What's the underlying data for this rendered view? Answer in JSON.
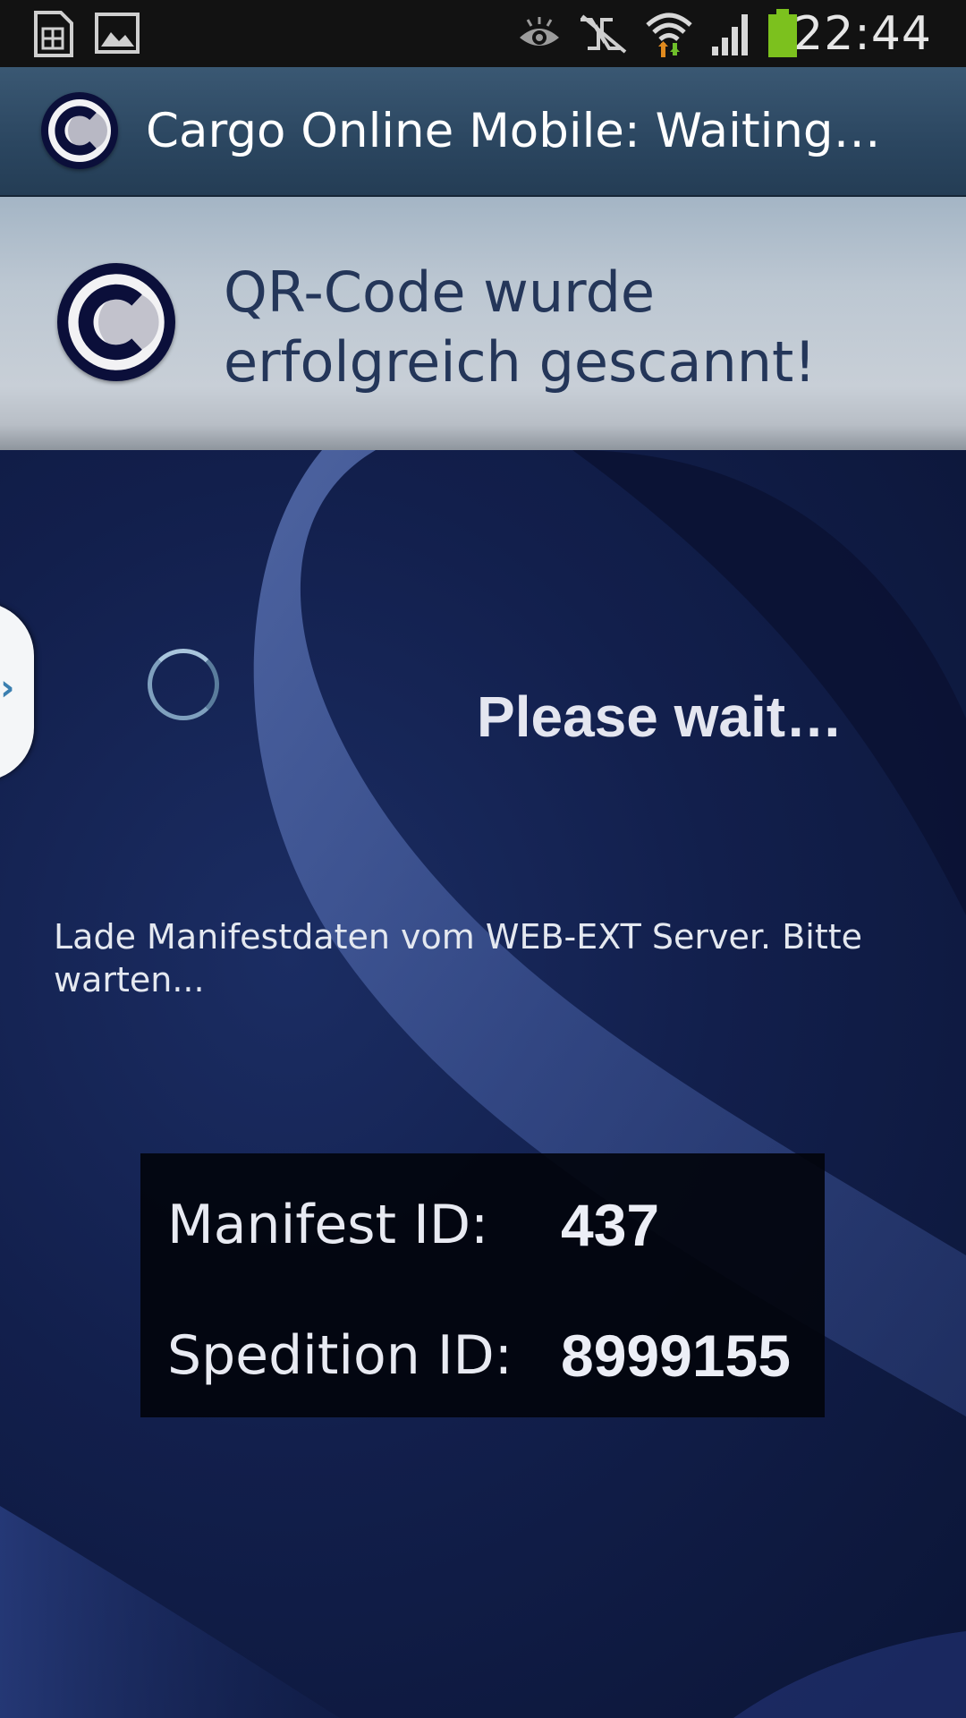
{
  "status_bar": {
    "time": "22:44",
    "icons": [
      "sim-card-icon",
      "gallery-icon",
      "eye-icon",
      "nfc-icon",
      "wifi-icon",
      "signal-icon",
      "battery-icon"
    ],
    "battery_color": "#7cc11e"
  },
  "action_bar": {
    "title": "Cargo Online Mobile: Waiting…",
    "logo_icon": "app-logo-icon"
  },
  "banner": {
    "title_line1": "QR-Code wurde",
    "title_line2": "erfolgreich gescannt!",
    "title_color": "#243659"
  },
  "main": {
    "side_tab_icon": "chevron-right-icon",
    "wait_text": "Please wait…",
    "info_text": "Lade Manifestdaten vom WEB-EXT Server. Bitte warten...",
    "ids": {
      "manifest_label": "Manifest ID:",
      "manifest_value": "437",
      "spedition_label": "Spedition ID:",
      "spedition_value": "8999155"
    }
  },
  "colors": {
    "action_bar": "#2b4660",
    "background": "#121f4c",
    "accent": "#5a7ab8"
  }
}
